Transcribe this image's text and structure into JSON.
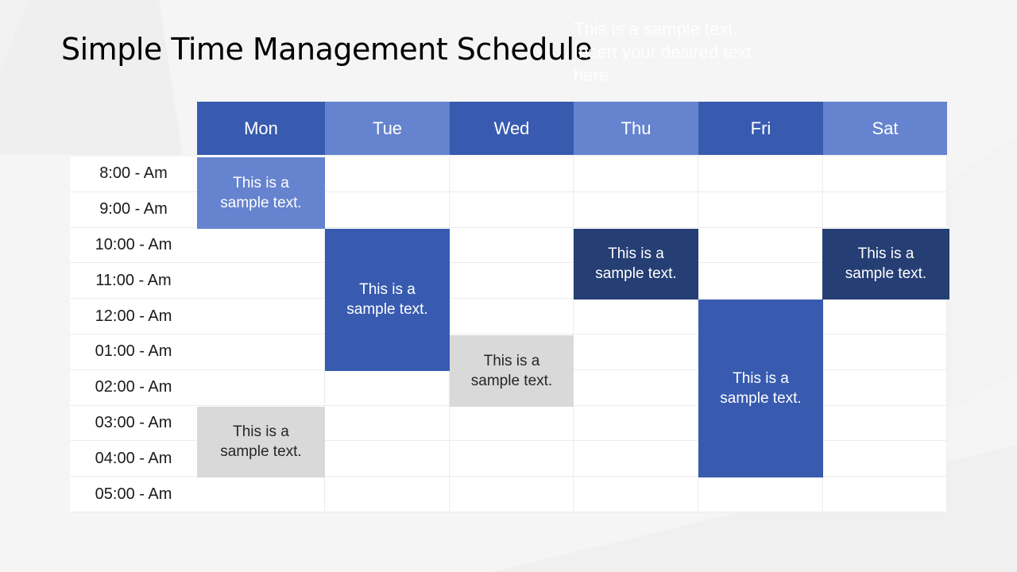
{
  "title": "Simple Time Management Schedule",
  "overlay_text": "This is a sample text. Insert your desired text here.",
  "colors": {
    "header_dark": "#385BB0",
    "header_light": "#6583CE",
    "block_light": "#6583CE",
    "block_mid": "#385BB0",
    "block_navy": "#253E74",
    "block_gray": "#D9D9D9",
    "background": "#F5F5F5"
  },
  "days": [
    "Mon",
    "Tue",
    "Wed",
    "Thu",
    "Fri",
    "Sat"
  ],
  "times": [
    "8:00 - Am",
    "9:00 - Am",
    "10:00 - Am",
    "11:00 - Am",
    "12:00 - Am",
    "01:00 - Am",
    "02:00 - Am",
    "03:00 - Am",
    "04:00 - Am",
    "05:00 - Am"
  ],
  "events": [
    {
      "day": "Mon",
      "start": "8:00 - Am",
      "end": "9:00 - Am",
      "text": "This is a sample text.",
      "style": "light"
    },
    {
      "day": "Tue",
      "start": "10:00 - Am",
      "end": "01:00 - Am",
      "text": "This is a sample text.",
      "style": "mid"
    },
    {
      "day": "Wed",
      "start": "01:00 - Am",
      "end": "02:00 - Am",
      "text": "This is a sample text.",
      "style": "gray"
    },
    {
      "day": "Thu",
      "start": "10:00 - Am",
      "end": "11:00 - Am",
      "text": "This is a sample text.",
      "style": "navy"
    },
    {
      "day": "Fri",
      "start": "12:00 - Am",
      "end": "04:00 - Am",
      "text": "This is a sample text.",
      "style": "mid"
    },
    {
      "day": "Sat",
      "start": "10:00 - Am",
      "end": "11:00 - Am",
      "text": "This is a sample text.",
      "style": "navy"
    },
    {
      "day": "Mon",
      "start": "03:00 - Am",
      "end": "04:00 - Am",
      "text": "This is a sample text.",
      "style": "gray"
    }
  ]
}
